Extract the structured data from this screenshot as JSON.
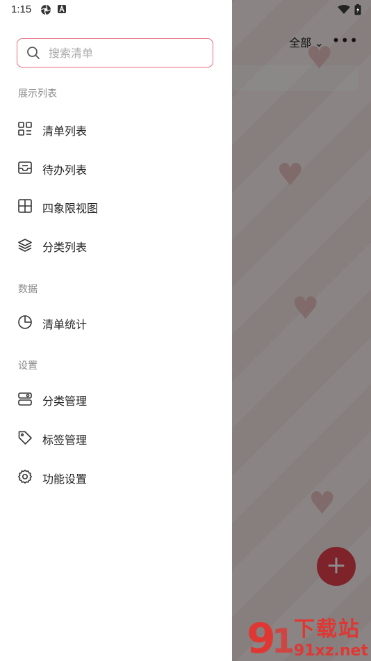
{
  "status_bar": {
    "time": "1:15"
  },
  "background_app": {
    "filter_label": "全部",
    "more_label": "•••",
    "add_label": "+"
  },
  "drawer": {
    "search_placeholder": "搜索清单",
    "sections": [
      {
        "title": "展示列表",
        "items": [
          {
            "label": "清单列表",
            "icon": "list-grid-icon"
          },
          {
            "label": "待办列表",
            "icon": "inbox-tray-icon"
          },
          {
            "label": "四象限视图",
            "icon": "quadrant-grid-icon"
          },
          {
            "label": "分类列表",
            "icon": "layers-icon"
          }
        ]
      },
      {
        "title": "数据",
        "items": [
          {
            "label": "清单统计",
            "icon": "pie-chart-icon"
          }
        ]
      },
      {
        "title": "设置",
        "items": [
          {
            "label": "分类管理",
            "icon": "category-manage-icon"
          },
          {
            "label": "标签管理",
            "icon": "tag-icon"
          },
          {
            "label": "功能设置",
            "icon": "gear-icon"
          }
        ]
      }
    ]
  },
  "watermark": {
    "site_name": "下载站",
    "domain": "91xz.net"
  },
  "colors": {
    "accent": "#e8414e",
    "search_border": "#e26a7a",
    "text_primary": "#222222",
    "text_secondary": "#8a8a8a"
  }
}
